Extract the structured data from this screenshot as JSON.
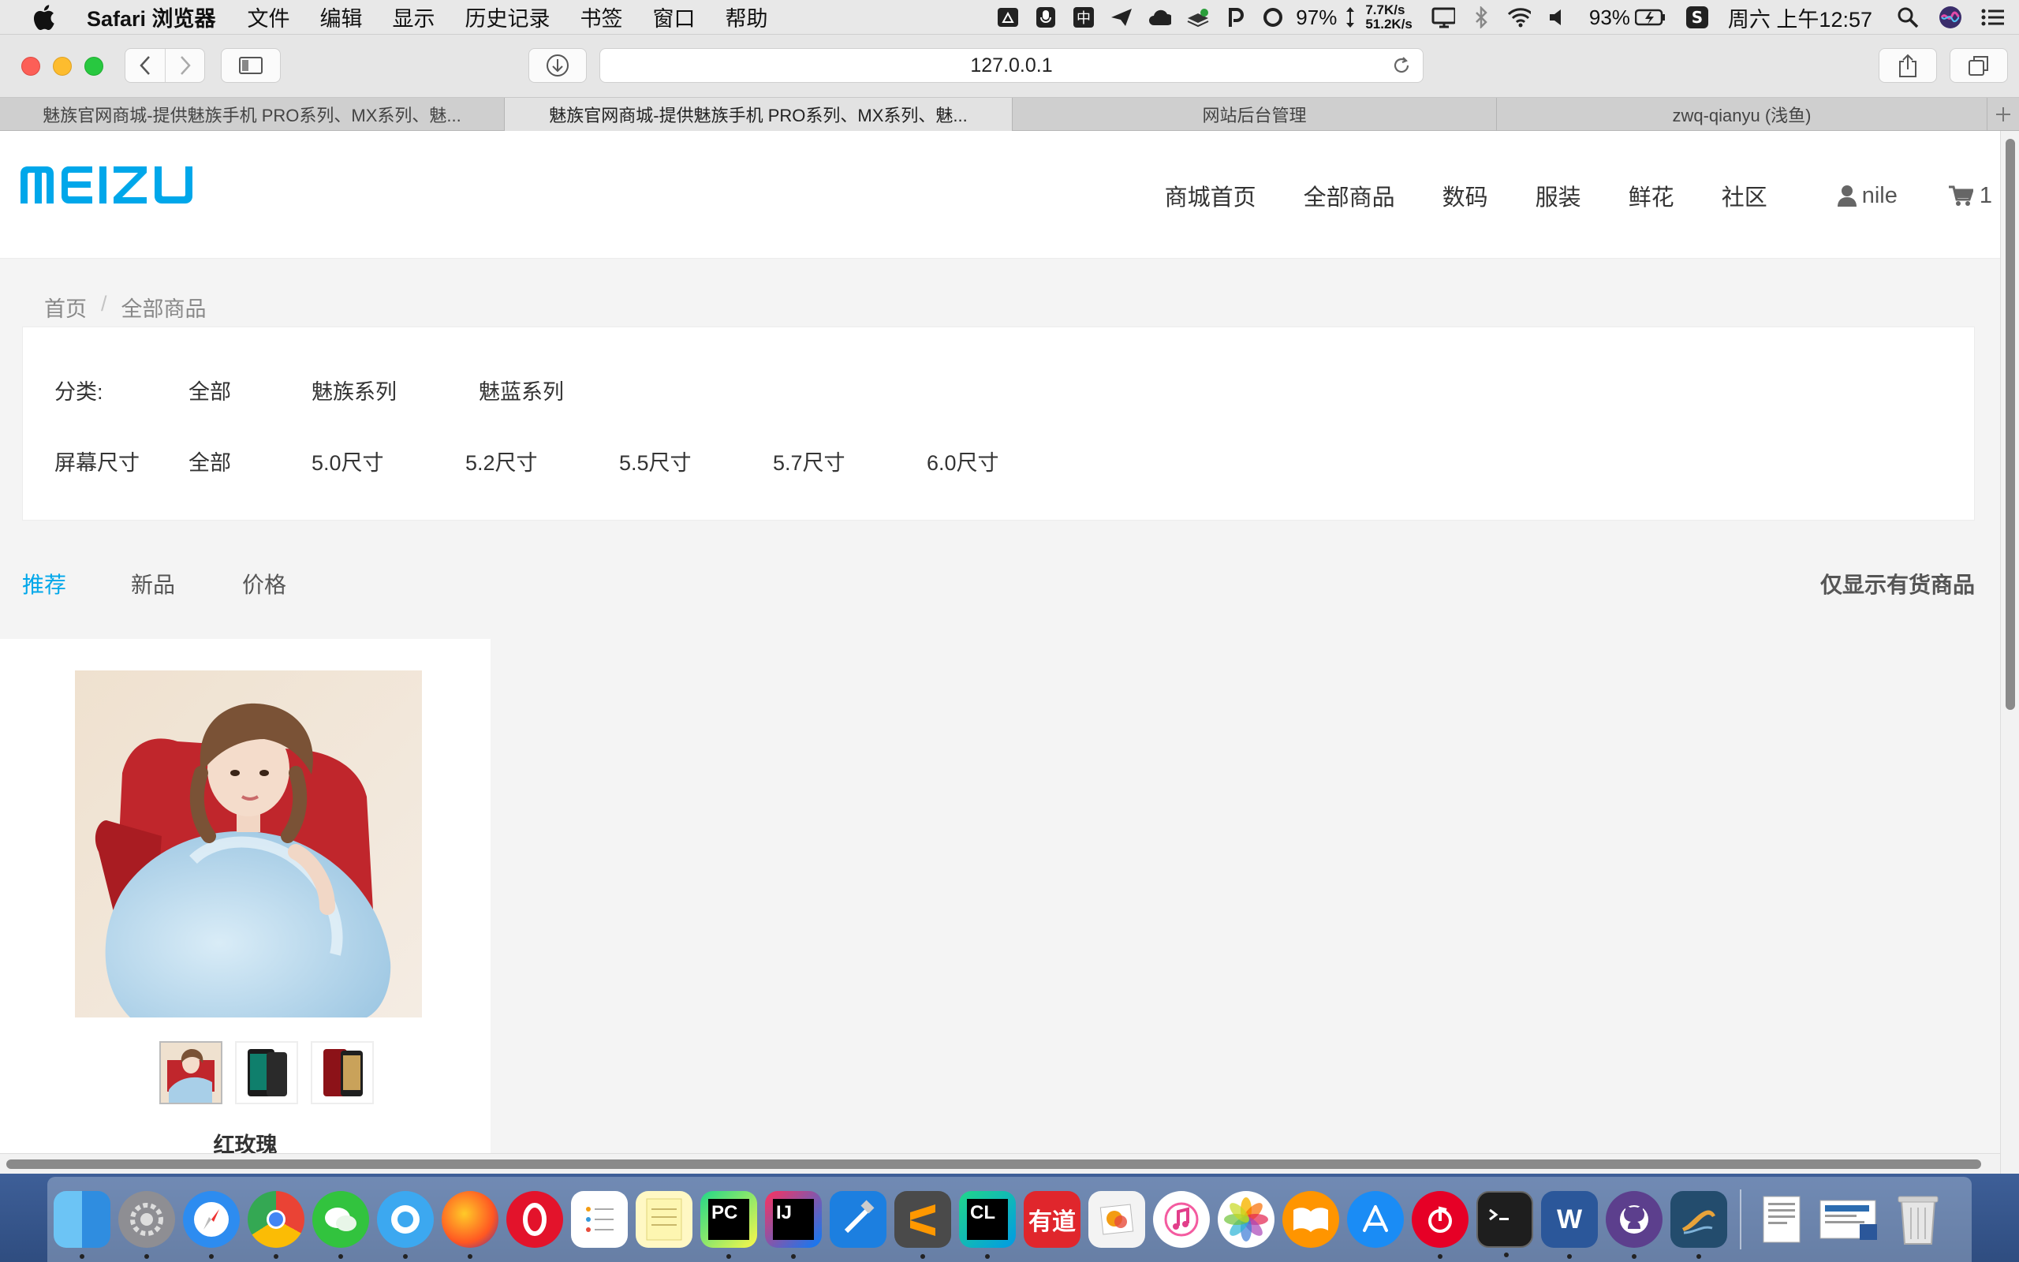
{
  "menubar": {
    "app_name": "Safari 浏览器",
    "items": [
      "文件",
      "编辑",
      "显示",
      "历史记录",
      "书签",
      "窗口",
      "帮助"
    ],
    "cpu_percent": "97%",
    "net_up": "7.7K/s",
    "net_down": "51.2K/s",
    "battery": "93%",
    "clock": "周六 上午12:57",
    "input_method": "中"
  },
  "browser": {
    "url": "127.0.0.1",
    "tabs": [
      {
        "title": "魅族官网商城-提供魅族手机 PRO系列、MX系列、魅...",
        "active": false
      },
      {
        "title": "魅族官网商城-提供魅族手机 PRO系列、MX系列、魅...",
        "active": true
      },
      {
        "title": "网站后台管理",
        "active": false
      },
      {
        "title": "zwq-qianyu (浅鱼)",
        "active": false
      }
    ]
  },
  "site": {
    "logo_text": "MEIZU",
    "brand_color": "#00a7ea",
    "nav": [
      "商城首页",
      "全部商品",
      "数码",
      "服装",
      "鲜花",
      "社区"
    ],
    "user_name": "nile",
    "cart_count": "1"
  },
  "breadcrumb": {
    "home": "首页",
    "separator": "/",
    "current": "全部商品"
  },
  "filters": {
    "category_label": "分类:",
    "category_options": [
      "全部",
      "魅族系列",
      "魅蓝系列"
    ],
    "screen_label": "屏幕尺寸",
    "screen_options": [
      "全部",
      "5.0尺寸",
      "5.2尺寸",
      "5.5尺寸",
      "5.7尺寸",
      "6.0尺寸"
    ]
  },
  "sort": {
    "options": [
      "推荐",
      "新品",
      "价格"
    ],
    "active": "推荐",
    "in_stock_only": "仅显示有货商品"
  },
  "products": [
    {
      "name": "红玫瑰",
      "thumbnails": [
        "portrait-photo",
        "black-phone",
        "red-phone"
      ]
    }
  ],
  "dock": [
    "finder",
    "system-preferences",
    "safari",
    "chrome",
    "wechat",
    "qq",
    "firefox",
    "opera",
    "reminders",
    "notes",
    "pycharm",
    "intellij",
    "xcode",
    "sublime",
    "clion",
    "youdao",
    "preview",
    "itunes",
    "photos",
    "ibooks",
    "app-store",
    "netease-music",
    "terminal",
    "word",
    "github",
    "mysql-workbench",
    "documents",
    "downloads",
    "trash"
  ]
}
